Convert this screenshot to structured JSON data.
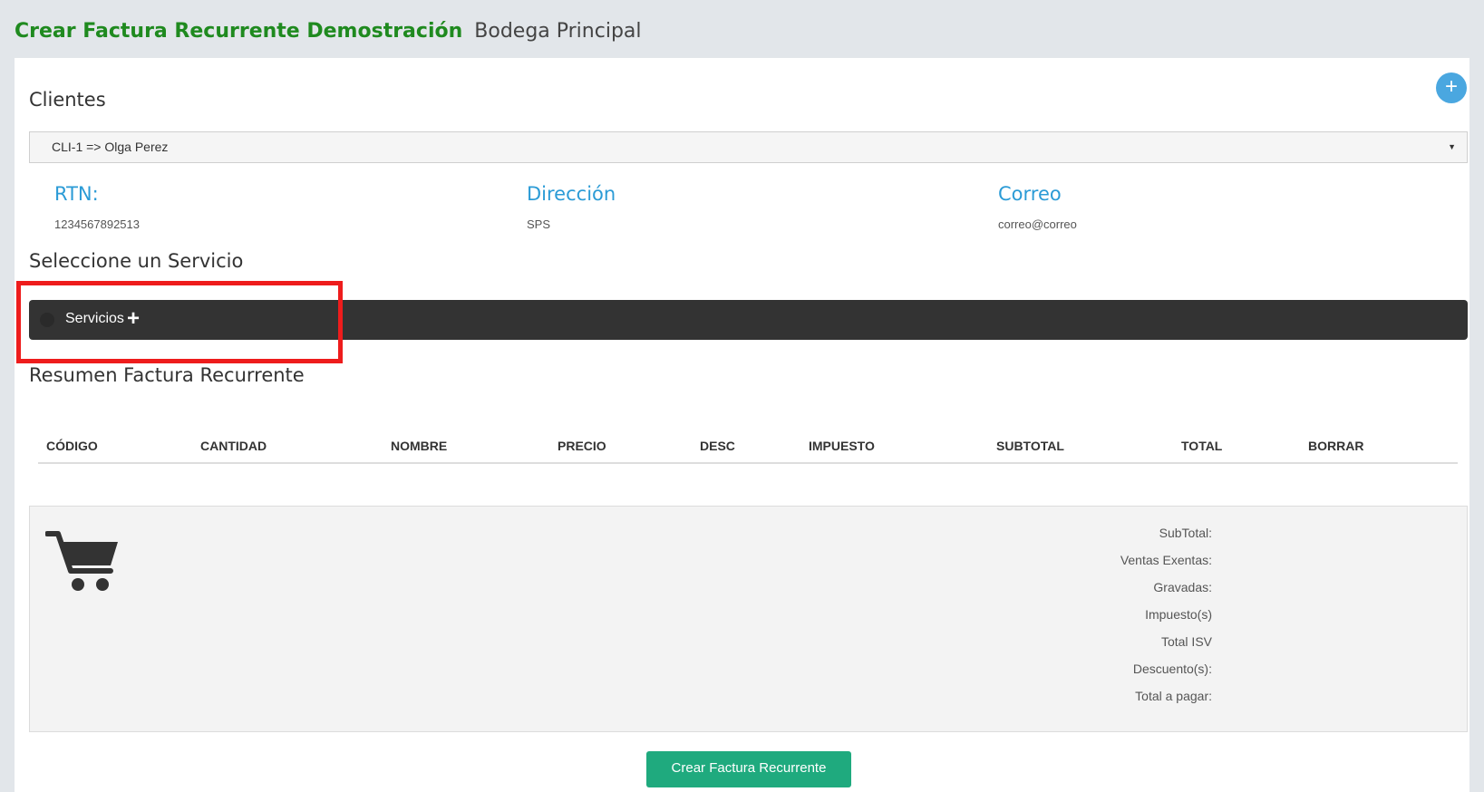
{
  "header": {
    "title": "Crear Factura Recurrente Demostración",
    "subtitle": "Bodega Principal"
  },
  "add_button": {
    "label": "+",
    "icon": "plus-icon",
    "color": "#4aa7e0"
  },
  "clients": {
    "title": "Clientes",
    "selected": "CLI-1 => Olga Perez",
    "caret": "▼"
  },
  "client_info": {
    "rtn_label": "RTN:",
    "rtn_value": "1234567892513",
    "address_label": "Dirección",
    "address_value": "SPS",
    "email_label": "Correo",
    "email_value": "correo@correo"
  },
  "services": {
    "title": "Seleccione un Servicio",
    "bar_label": "Servicios",
    "plus": "+"
  },
  "summary": {
    "title": "Resumen Factura Recurrente",
    "columns": [
      "CÓDIGO",
      "CANTIDAD",
      "NOMBRE",
      "PRECIO",
      "DESC",
      "IMPUESTO",
      "SUBTOTAL",
      "TOTAL",
      "BORRAR"
    ],
    "totals": [
      "SubTotal:",
      "Ventas Exentas:",
      "Gravadas:",
      "Impuesto(s)",
      "Total ISV",
      "Descuento(s):",
      "Total a pagar:"
    ],
    "cart_icon": "shopping-cart-icon"
  },
  "submit": {
    "label": "Crear Factura Recurrente",
    "color": "#1faa7e"
  },
  "colors": {
    "title_green": "#1f8a1f",
    "label_blue": "#2b9bd6",
    "dark_bar": "#333333",
    "highlight_red": "#ee1c1c"
  }
}
